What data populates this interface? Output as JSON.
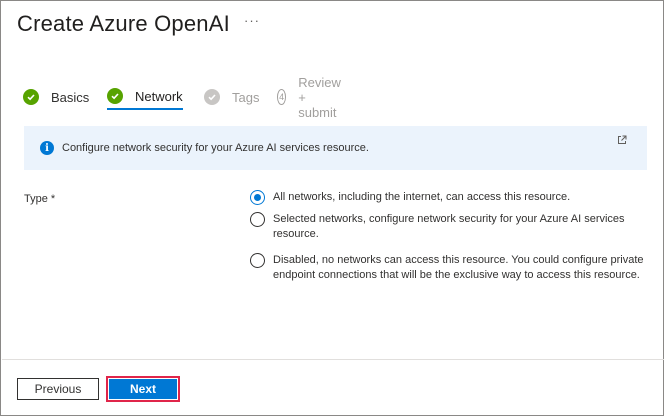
{
  "header": {
    "title": "Create Azure OpenAI",
    "more": "···"
  },
  "steps": [
    {
      "label": "Basics",
      "state": "done"
    },
    {
      "label": "Network",
      "state": "active"
    },
    {
      "label": "Tags",
      "state": "todo"
    },
    {
      "label": "Review + submit",
      "state": "todo",
      "number": "4"
    }
  ],
  "banner": {
    "text": "Configure network security for your Azure AI services resource.",
    "icon": "info-icon"
  },
  "form": {
    "type_label": "Type *",
    "options": [
      {
        "text": "All networks, including the internet, can access this resource.",
        "selected": true
      },
      {
        "text": "Selected networks, configure network security for your Azure AI services resource.",
        "selected": false
      },
      {
        "text": "Disabled, no networks can access this resource. You could configure private endpoint connections that will be the exclusive way to access this resource.",
        "selected": false
      }
    ]
  },
  "footer": {
    "previous_label": "Previous",
    "next_label": "Next"
  },
  "colors": {
    "accent": "#0078d4",
    "success": "#57a300",
    "highlight": "#e0254a",
    "banner_bg": "#ebf3fc"
  }
}
